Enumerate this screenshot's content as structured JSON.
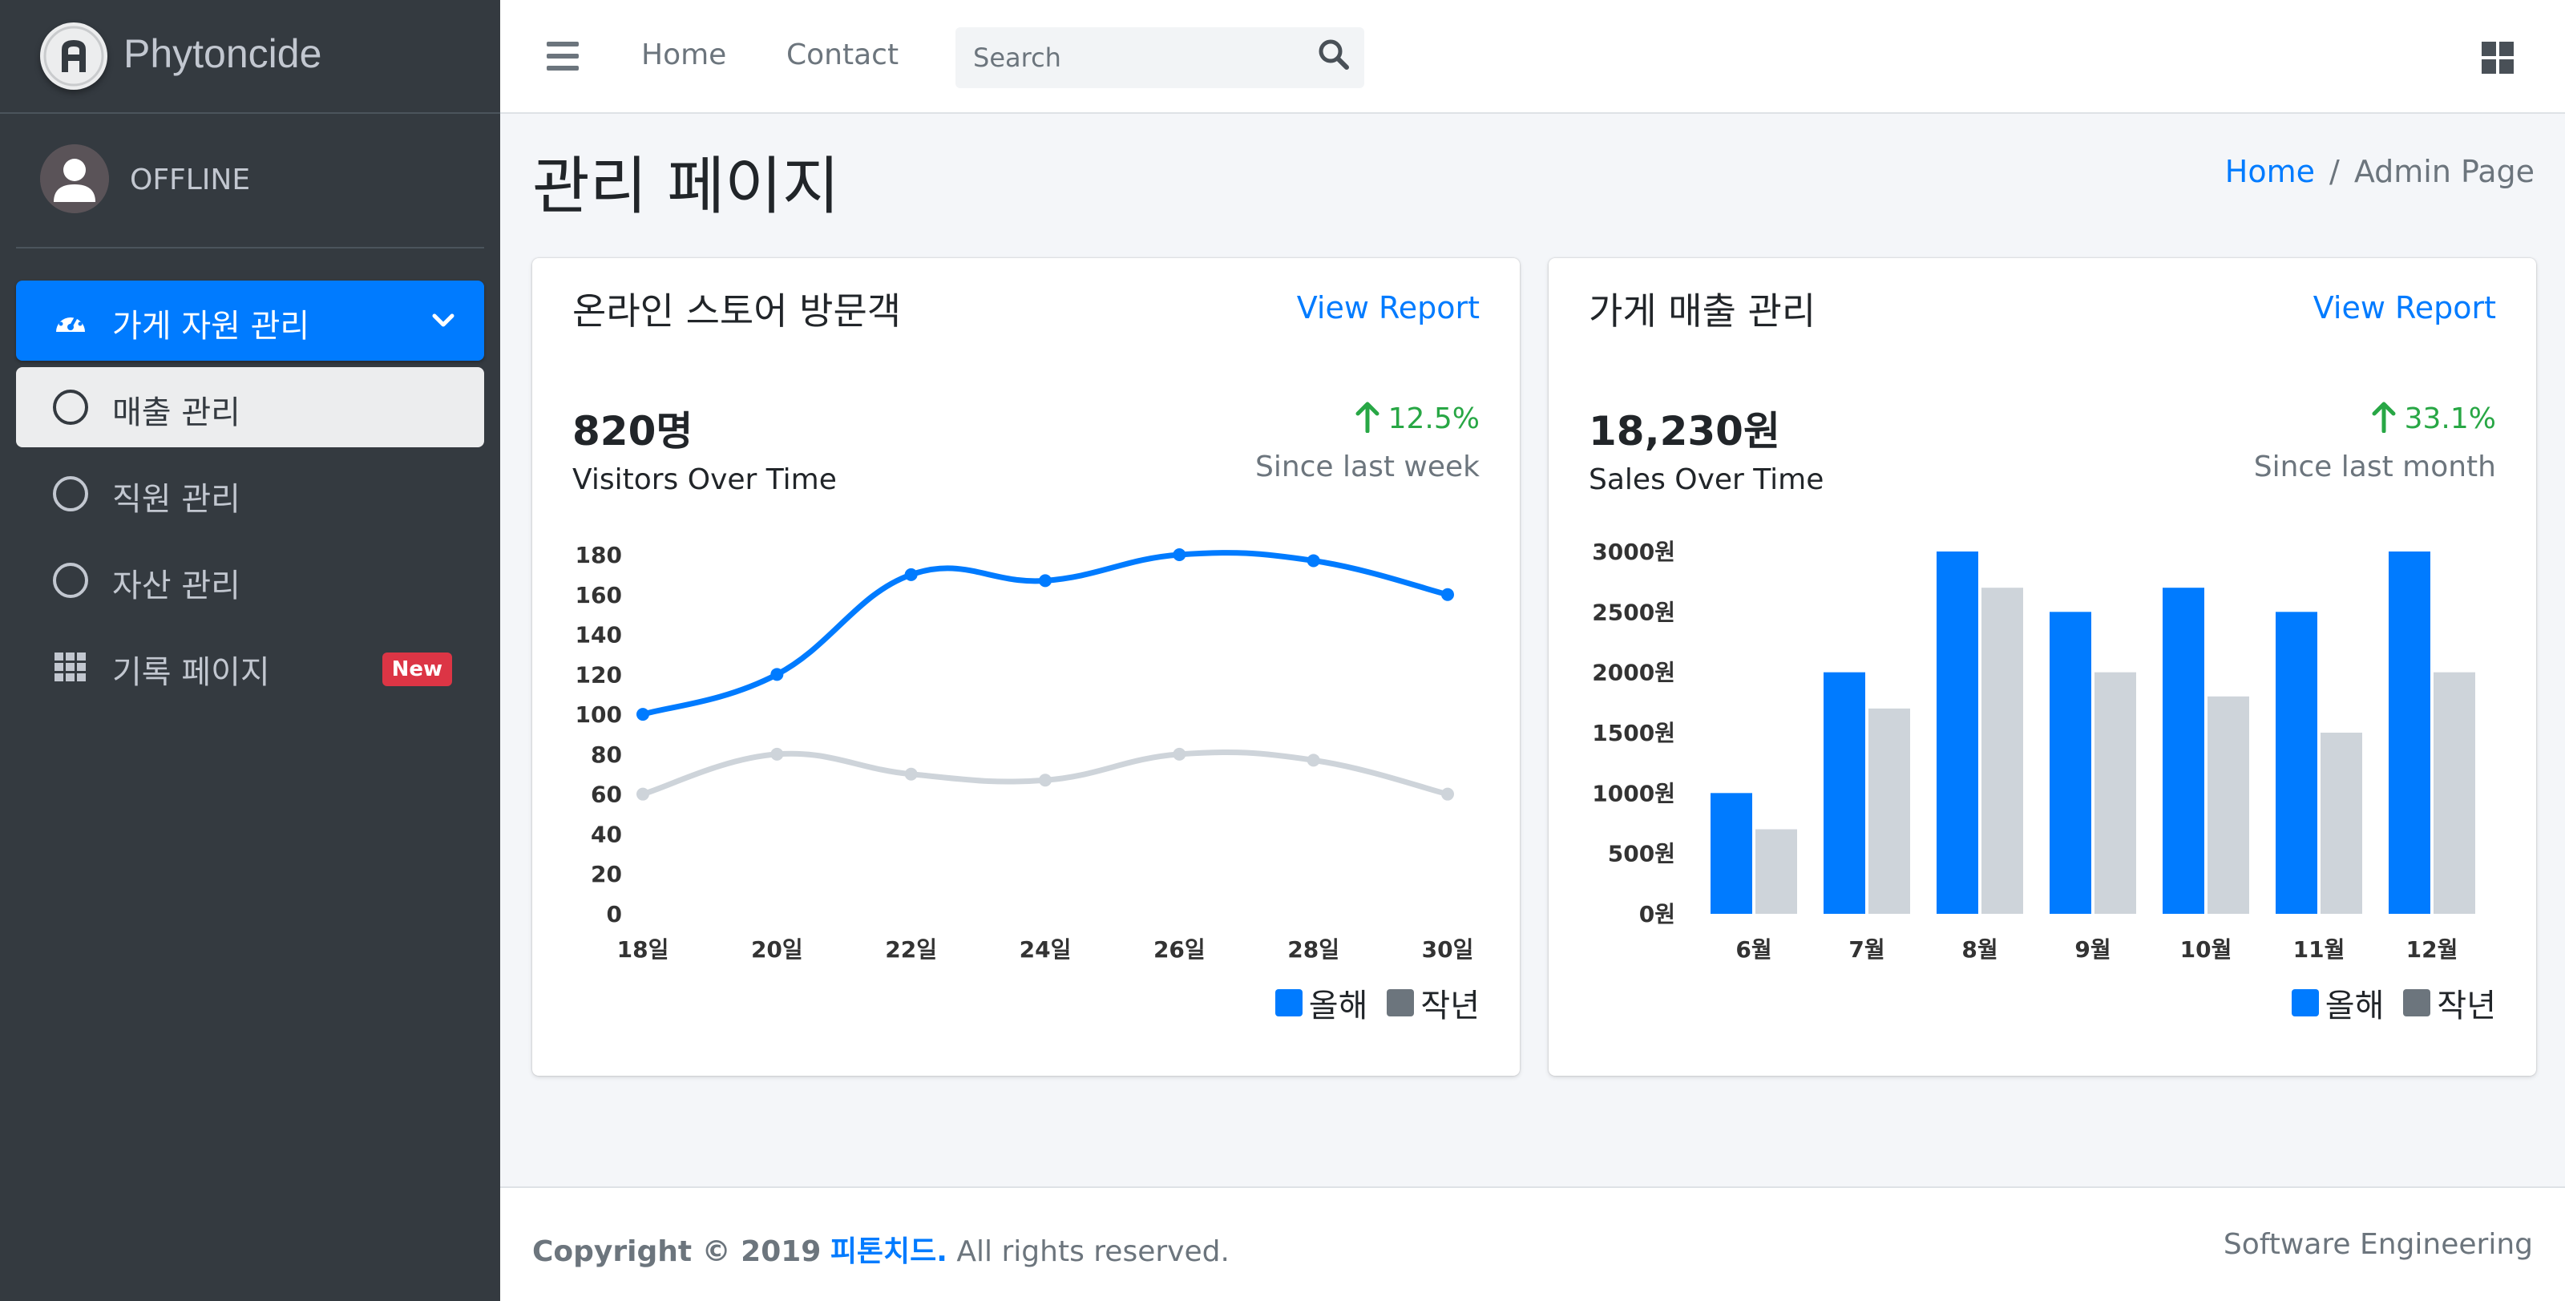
{
  "brand": {
    "name": "Phytoncide"
  },
  "user": {
    "status": "OFFLINE"
  },
  "sidebar": {
    "items": [
      {
        "label": "가게 자원 관리",
        "icon": "tachometer-icon"
      },
      {
        "label": "매출 관리",
        "icon": "circle-icon"
      },
      {
        "label": "직원 관리",
        "icon": "circle-icon"
      },
      {
        "label": "자산 관리",
        "icon": "circle-icon"
      },
      {
        "label": "기록 페이지",
        "icon": "grid-icon",
        "badge": "New"
      }
    ]
  },
  "topbar": {
    "links": [
      "Home",
      "Contact"
    ],
    "search_placeholder": "Search"
  },
  "page": {
    "title": "관리 페이지",
    "breadcrumb": {
      "home": "Home",
      "separator": "/",
      "current": "Admin Page"
    }
  },
  "cards": [
    {
      "title": "온라인 스토어 방문객",
      "link": "View Report",
      "value": "820명",
      "label": "Visitors Over Time",
      "growth": "12.5%",
      "since": "Since last week",
      "legend": [
        "올해",
        "작년"
      ]
    },
    {
      "title": "가게 매출 관리",
      "link": "View Report",
      "value": "18,230원",
      "label": "Sales Over Time",
      "growth": "33.1%",
      "since": "Since last month",
      "legend": [
        "올해",
        "작년"
      ]
    }
  ],
  "colors": {
    "primary": "#007bff",
    "secondary": "#ced4da",
    "legend_secondary": "#6c757d",
    "success": "#28a745",
    "danger": "#dc3545"
  },
  "chart_data": [
    {
      "type": "line",
      "categories": [
        "18일",
        "20일",
        "22일",
        "24일",
        "26일",
        "28일",
        "30일"
      ],
      "series": [
        {
          "name": "올해",
          "values": [
            100,
            120,
            170,
            167,
            180,
            177,
            160
          ]
        },
        {
          "name": "작년",
          "values": [
            60,
            80,
            70,
            67,
            80,
            77,
            60
          ]
        }
      ],
      "yticks": [
        "0",
        "20",
        "40",
        "60",
        "80",
        "100",
        "120",
        "140",
        "160",
        "180"
      ],
      "ylim": [
        0,
        180
      ]
    },
    {
      "type": "bar",
      "categories": [
        "6월",
        "7월",
        "8월",
        "9월",
        "10월",
        "11월",
        "12월"
      ],
      "series": [
        {
          "name": "올해",
          "values": [
            1000,
            2000,
            3000,
            2500,
            2700,
            2500,
            3000
          ]
        },
        {
          "name": "작년",
          "values": [
            700,
            1700,
            2700,
            2000,
            1800,
            1500,
            2000
          ]
        }
      ],
      "yticks": [
        "0원",
        "500원",
        "1000원",
        "1500원",
        "2000원",
        "2500원",
        "3000원"
      ],
      "ylim": [
        0,
        3000
      ]
    }
  ],
  "footer": {
    "copyright": "Copyright © 2019",
    "company": "피톤치드.",
    "rights": "All rights reserved.",
    "right_text": "Software Engineering"
  }
}
